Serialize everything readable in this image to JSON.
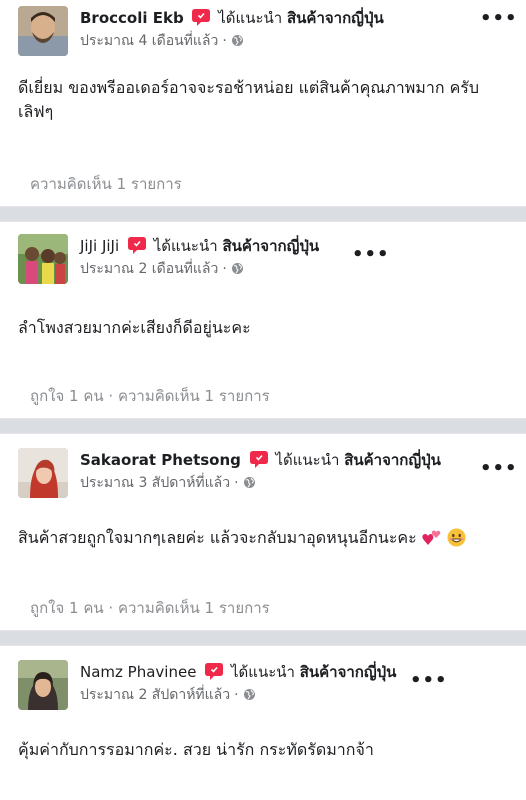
{
  "reviews": [
    {
      "author": "Broccoli Ekb",
      "verb": "ได้แนะนำ",
      "page": "สินค้าจากญี่ปุ่น",
      "time": "ประมาณ 4 เดือนที่แล้ว",
      "dot": "·",
      "more": "•••",
      "text": "ดีเยี่ยม ของพรีออเดอร์อาจจะรอช้าหน่อย แต่สินค้าคุณภาพมาก ครับ เลิฟๆ",
      "likes": "",
      "sep": "",
      "comments": "ความคิดเห็น 1 รายการ"
    },
    {
      "author": "JiJi JiJi",
      "verb": "ได้แนะนำ",
      "page": "สินค้าจากญี่ปุ่น",
      "time": "ประมาณ 2 เดือนที่แล้ว",
      "dot": "·",
      "more": "•••",
      "text": "ลำโพงสวยมากค่ะเสียงก็ดีอยู่นะคะ",
      "likes": "ถูกใจ 1 คน",
      "sep": " · ",
      "comments": "ความคิดเห็น 1 รายการ"
    },
    {
      "author": "Sakaorat Phetsong",
      "verb": "ได้แนะนำ",
      "page": "สินค้าจากญี่ปุ่น",
      "time": "ประมาณ 3 สัปดาห์ที่แล้ว",
      "dot": "·",
      "more": "•••",
      "text": "สินค้าสวยถูกใจมากๆเลยค่ะ แล้วจะกลับมาอุดหนุนอีกนะคะ",
      "likes": "ถูกใจ 1 คน",
      "sep": " · ",
      "comments": "ความคิดเห็น 1 รายการ"
    },
    {
      "author": "Namz Phavinee",
      "verb": "ได้แนะนำ",
      "page": "สินค้าจากญี่ปุ่น",
      "time": "ประมาณ 2 สัปดาห์ที่แล้ว",
      "dot": "·",
      "more": "•••",
      "text": "คุ้มค่ากับการรอมากค่ะ. สวย น่ารัก กระทัดรัดมากจ้า",
      "likes": "",
      "sep": "",
      "comments": ""
    }
  ],
  "icons": {
    "recommend": "recommend-icon",
    "globe": "globe-icon",
    "more": "more-options-icon",
    "emoji_heart": "two-hearts-emoji",
    "emoji_smile": "grinning-face-emoji"
  },
  "colors": {
    "recommend_red": "#f02849",
    "meta_gray": "#8a8d91",
    "separator": "#dadde1"
  }
}
